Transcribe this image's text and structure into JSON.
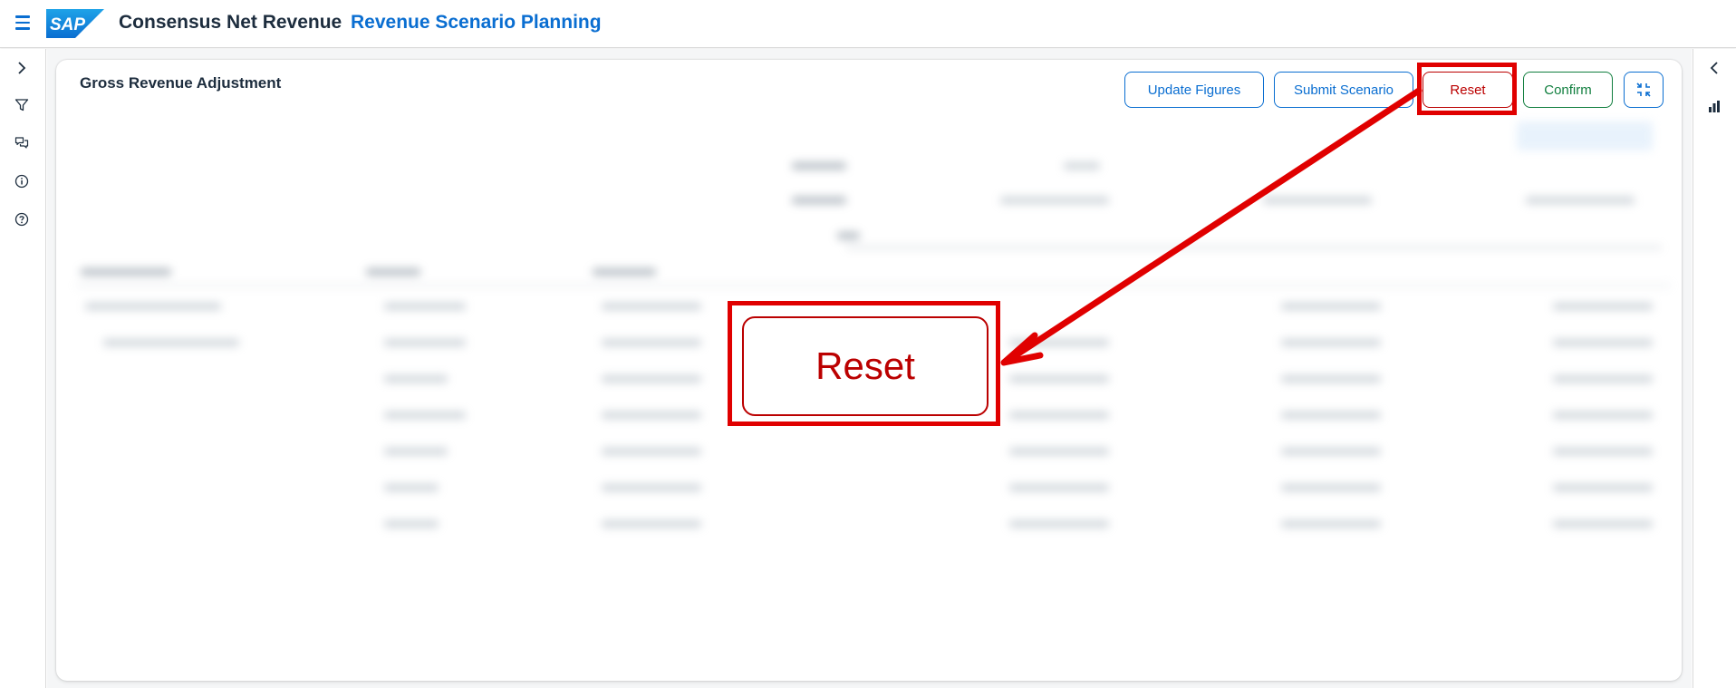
{
  "shell": {
    "logo_text": "SAP",
    "app_title": "Consensus Net Revenue",
    "app_subtitle": "Revenue Scenario Planning"
  },
  "leftnav": {
    "icons": [
      "chevron-right-icon",
      "filter-icon",
      "comments-icon",
      "info-icon",
      "help-icon"
    ]
  },
  "rightnav": {
    "icons": [
      "chevron-left-icon",
      "bar-chart-icon"
    ]
  },
  "card": {
    "title": "Gross Revenue Adjustment",
    "buttons": {
      "update": "Update Figures",
      "submit": "Submit Scenario",
      "reset": "Reset",
      "confirm": "Confirm",
      "exit_fullscreen_icon": "exit-fullscreen-icon"
    }
  },
  "annotation": {
    "zoom_label": "Reset"
  },
  "colors": {
    "brand_blue": "#0a6ed1",
    "reset_red": "#bb0000",
    "confirm_green": "#107e3e",
    "annotation_red": "#e00000"
  }
}
